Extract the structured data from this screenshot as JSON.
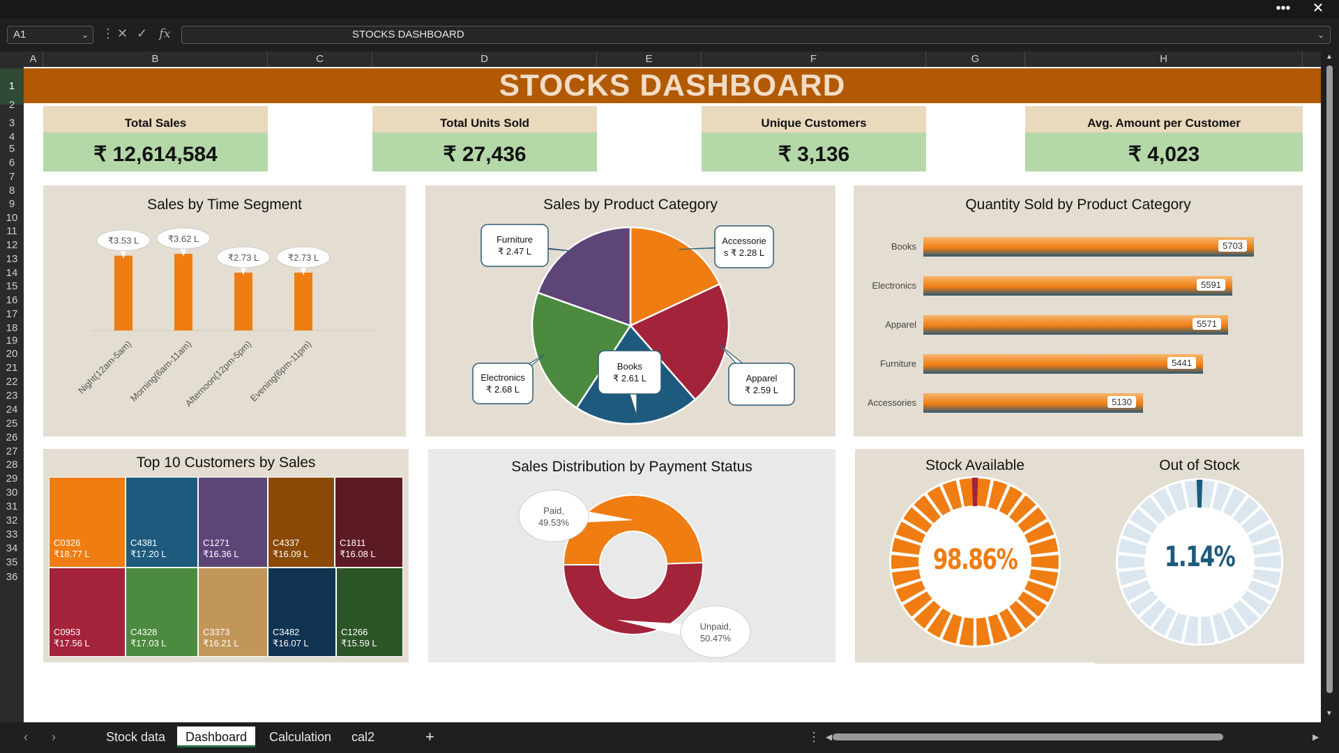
{
  "window": {
    "more_label": "•••",
    "close_label": "✕"
  },
  "formula_bar": {
    "name_box": "A1",
    "formula": "STOCKS   DASHBOARD"
  },
  "columns": [
    "A",
    "B",
    "C",
    "D",
    "E",
    "F",
    "G",
    "H"
  ],
  "rows": [
    "1",
    "2",
    "3",
    "4",
    "5",
    "6",
    "7",
    "8",
    "9",
    "10",
    "11",
    "12",
    "13",
    "14",
    "15",
    "16",
    "17",
    "18",
    "19",
    "20",
    "21",
    "22",
    "23",
    "24",
    "25",
    "26",
    "27",
    "28",
    "29",
    "30",
    "31",
    "32",
    "33",
    "34",
    "35",
    "36"
  ],
  "dashboard": {
    "title": "STOCKS   DASHBOARD",
    "kpis": [
      {
        "label": "Total Sales",
        "value": "₹ 12,614,584"
      },
      {
        "label": "Total Units Sold",
        "value": "₹ 27,436"
      },
      {
        "label": "Unique Customers",
        "value": "₹ 3,136"
      },
      {
        "label": "Avg. Amount per Customer",
        "value": "₹ 4,023"
      }
    ],
    "colors": {
      "orange": "#ef7d12",
      "red": "#a3233a",
      "blue": "#1e5a7e",
      "purple": "#5e4578",
      "green": "#4c8a3f",
      "banner": "#b15a03"
    }
  },
  "chart_data": [
    {
      "type": "bar",
      "title": "Sales by Time Segment",
      "categories": [
        "Night(12am-5am)",
        "Morning(6am-11am)",
        "Afternoon(12pm-5pm)",
        "Evening(6pm-11pm)"
      ],
      "values": [
        3.53,
        3.62,
        2.73,
        2.73
      ],
      "data_labels": [
        "₹3.53 L",
        "₹3.62 L",
        "₹2.73 L",
        "₹2.73 L"
      ],
      "ylim": [
        0,
        3.62
      ]
    },
    {
      "type": "pie",
      "title": "Sales by Product Category",
      "categories": [
        "Accessories",
        "Apparel",
        "Books",
        "Electronics",
        "Furniture"
      ],
      "values": [
        2.28,
        2.59,
        2.61,
        2.68,
        2.47
      ],
      "data_labels": [
        "Accessorie\ns ₹ 2.28 L",
        "Apparel\n₹ 2.59 L",
        "Books\n₹ 2.61 L",
        "Electronics\n₹ 2.68 L",
        "Furniture\n₹ 2.47 L"
      ]
    },
    {
      "type": "bar",
      "title": "Quantity Sold by Product Category",
      "orientation": "horizontal",
      "categories": [
        "Books",
        "Electronics",
        "Apparel",
        "Furniture",
        "Accessories"
      ],
      "values": [
        5703,
        5591,
        5571,
        5441,
        5130
      ]
    },
    {
      "type": "table",
      "title": "Top 10 Customers by Sales",
      "categories": [
        "C0326",
        "C4381",
        "C1271",
        "C4337",
        "C1811",
        "C0953",
        "C4328",
        "C3373",
        "C3482",
        "C1266"
      ],
      "data_labels": [
        "₹18.77 L",
        "₹17.20 L",
        "₹16.36 L",
        "₹16.09 L",
        "₹16.08 L",
        "₹17.56 L",
        "₹17.03 L",
        "₹16.21 L",
        "₹16.07 L",
        "₹15.59 L"
      ],
      "values": [
        18.77,
        17.2,
        16.36,
        16.09,
        16.08,
        17.56,
        17.03,
        16.21,
        16.07,
        15.59
      ]
    },
    {
      "type": "pie",
      "title": "Sales Distribution by Payment Status",
      "categories": [
        "Paid",
        "Unpaid"
      ],
      "values": [
        49.53,
        50.47
      ],
      "data_labels": [
        "Paid,\n49.53%",
        "Unpaid,\n50.47%"
      ]
    },
    {
      "type": "pie",
      "title": "Stock Available",
      "values": [
        98.86,
        1.14
      ],
      "data_labels": [
        "98.86%"
      ]
    },
    {
      "type": "pie",
      "title": "Out of Stock",
      "values": [
        1.14,
        98.86
      ],
      "data_labels": [
        "1.14%"
      ]
    }
  ],
  "sheet_tabs": [
    "Stock data",
    "Dashboard",
    "Calculation",
    "cal2"
  ],
  "add_sheet": "+"
}
